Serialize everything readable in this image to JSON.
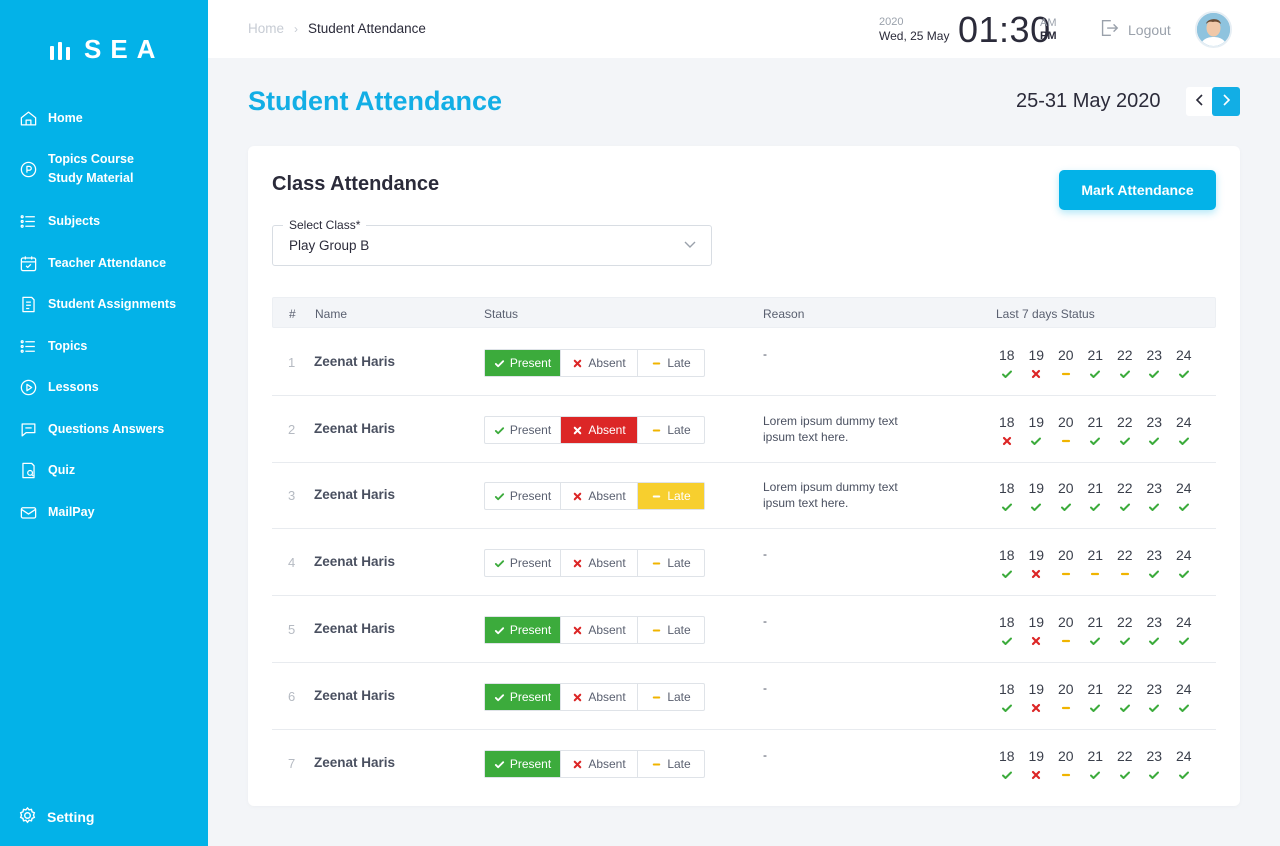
{
  "app": {
    "logo_text": "SEA"
  },
  "sidebar": {
    "items": [
      {
        "label": "Home",
        "icon": "home-icon"
      },
      {
        "label": "Topics Course\nStudy Material",
        "icon": "course-icon"
      },
      {
        "label": "Subjects",
        "icon": "list-icon"
      },
      {
        "label": "Teacher Attendance",
        "icon": "calendar-icon"
      },
      {
        "label": "Student Assignments",
        "icon": "assignment-icon"
      },
      {
        "label": "Topics",
        "icon": "list-icon"
      },
      {
        "label": "Lessons",
        "icon": "play-icon"
      },
      {
        "label": "Questions Answers",
        "icon": "chat-icon"
      },
      {
        "label": "Quiz",
        "icon": "quiz-icon"
      },
      {
        "label": "MailPay",
        "icon": "mail-icon"
      }
    ],
    "setting_label": "Setting"
  },
  "topbar": {
    "breadcrumb_home": "Home",
    "breadcrumb_current": "Student Attendance",
    "year": "2020",
    "day": "Wed, 25 May",
    "time": "01:30",
    "am": "AM",
    "pm": "PM",
    "logout_label": "Logout"
  },
  "page": {
    "title": "Student Attendance",
    "week_range": "25-31 May 2020"
  },
  "card": {
    "title": "Class Attendance",
    "mark_button": "Mark Attendance",
    "select_label": "Select Class*",
    "select_value": "Play Group B"
  },
  "table": {
    "headers": {
      "num": "#",
      "name": "Name",
      "status": "Status",
      "reason": "Reason",
      "last7": "Last 7 days Status"
    },
    "option_labels": {
      "present": "Present",
      "absent": "Absent",
      "late": "Late"
    },
    "days": [
      "18",
      "19",
      "20",
      "21",
      "22",
      "23",
      "24"
    ],
    "rows": [
      {
        "num": "1",
        "name": "Zeenat Haris",
        "status": "present",
        "reason": "-",
        "last7": [
          "p",
          "a",
          "l",
          "p",
          "p",
          "p",
          "p"
        ]
      },
      {
        "num": "2",
        "name": "Zeenat Haris",
        "status": "absent",
        "reason": "Lorem ipsum dummy text ipsum text here.",
        "last7": [
          "a",
          "p",
          "l",
          "p",
          "p",
          "p",
          "p"
        ]
      },
      {
        "num": "3",
        "name": "Zeenat Haris",
        "status": "late",
        "reason": "Lorem ipsum dummy text ipsum text here.",
        "last7": [
          "p",
          "p",
          "p",
          "p",
          "p",
          "p",
          "p"
        ]
      },
      {
        "num": "4",
        "name": "Zeenat Haris",
        "status": "none",
        "reason": "-",
        "last7": [
          "p",
          "a",
          "l",
          "l",
          "l",
          "p",
          "p"
        ]
      },
      {
        "num": "5",
        "name": "Zeenat Haris",
        "status": "present",
        "reason": "-",
        "last7": [
          "p",
          "a",
          "l",
          "p",
          "p",
          "p",
          "p"
        ]
      },
      {
        "num": "6",
        "name": "Zeenat Haris",
        "status": "present",
        "reason": "-",
        "last7": [
          "p",
          "a",
          "l",
          "p",
          "p",
          "p",
          "p"
        ]
      },
      {
        "num": "7",
        "name": "Zeenat Haris",
        "status": "present",
        "reason": "-",
        "last7": [
          "p",
          "a",
          "l",
          "p",
          "p",
          "p",
          "p"
        ]
      }
    ]
  },
  "colors": {
    "primary": "#03b2e8",
    "present": "#3cab3c",
    "absent": "#dc2626",
    "late": "#f7cf2e"
  }
}
